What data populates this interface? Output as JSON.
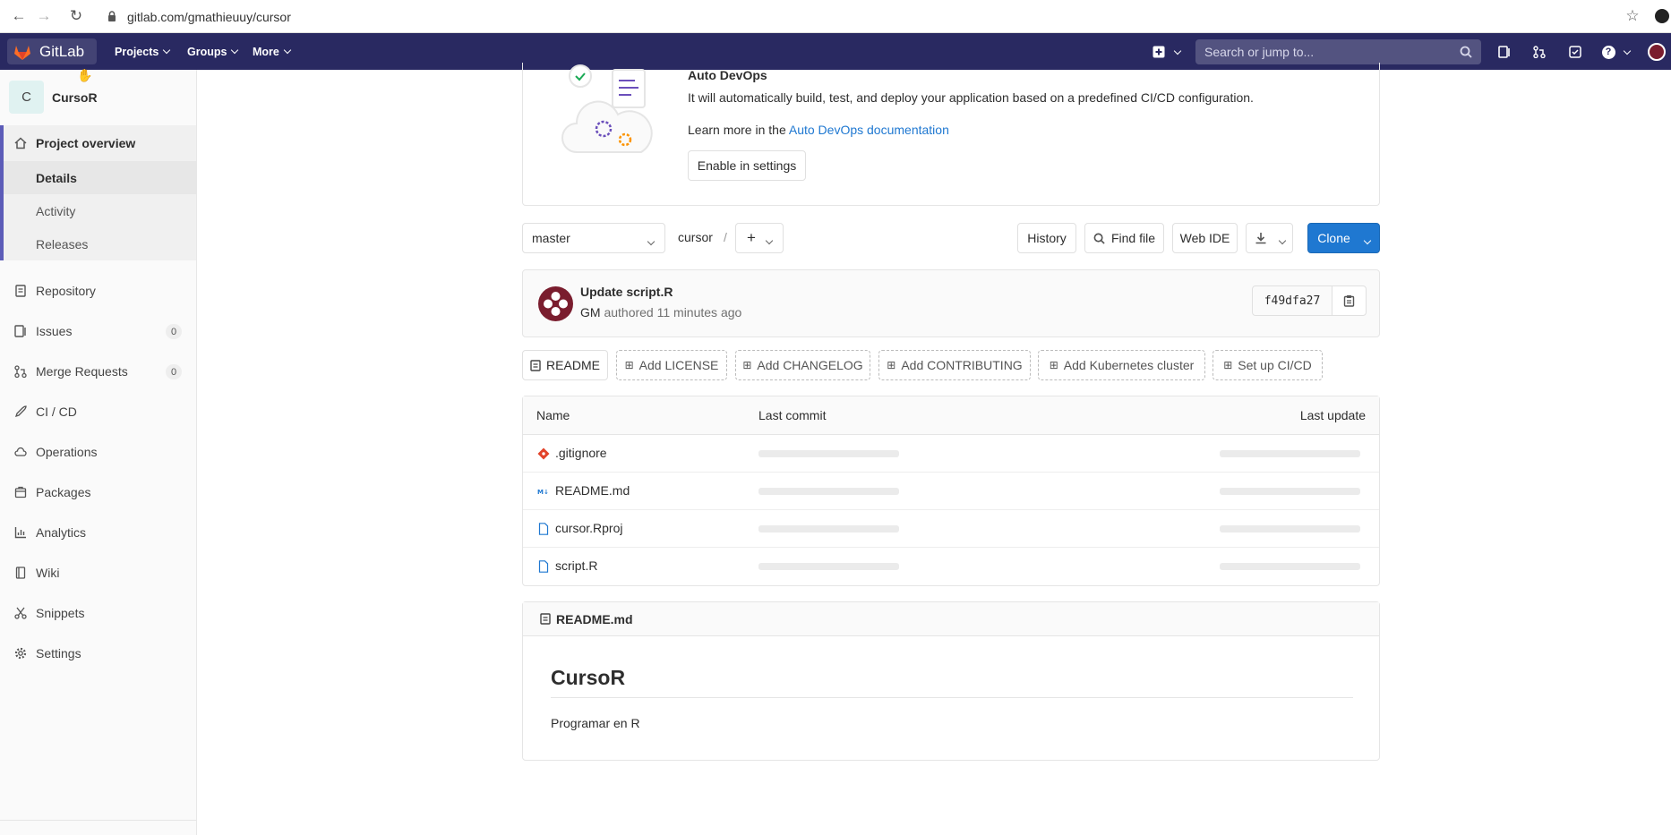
{
  "browser": {
    "url": "gitlab.com/gmathieuuy/cursor"
  },
  "topbar": {
    "brand": "GitLab",
    "nav": [
      "Projects",
      "Groups",
      "More"
    ],
    "search_placeholder": "Search or jump to..."
  },
  "sidebar": {
    "project_initial": "C",
    "project_name": "CursoR",
    "overview": "Project overview",
    "sub": [
      "Details",
      "Activity",
      "Releases"
    ],
    "items": [
      "Repository",
      "Issues",
      "Merge Requests",
      "CI / CD",
      "Operations",
      "Packages",
      "Analytics",
      "Wiki",
      "Snippets",
      "Settings"
    ],
    "issues_count": "0",
    "mr_count": "0"
  },
  "devops": {
    "title": "Auto DevOps",
    "description": "It will automatically build, test, and deploy your application based on a predefined CI/CD configuration.",
    "learn_prefix": "Learn more in the",
    "learn_link": "Auto DevOps documentation",
    "enable_button": "Enable in settings"
  },
  "repo_bar": {
    "branch": "master",
    "path": "cursor",
    "separator": "/",
    "history": "History",
    "find_file": "Find file",
    "web_ide": "Web IDE",
    "clone": "Clone"
  },
  "commit": {
    "title": "Update script.R",
    "author": "GM",
    "meta": "authored 11 minutes ago",
    "sha": "f49dfa27"
  },
  "quick_links": [
    "README",
    "Add LICENSE",
    "Add CHANGELOG",
    "Add CONTRIBUTING",
    "Add Kubernetes cluster",
    "Set up CI/CD"
  ],
  "tree": {
    "headers": [
      "Name",
      "Last commit",
      "Last update"
    ],
    "files": [
      ".gitignore",
      "README.md",
      "cursor.Rproj",
      "script.R"
    ]
  },
  "readme": {
    "file_label": "README.md",
    "heading": "CursoR",
    "body": "Programar en R"
  },
  "colors": {
    "topbar": "#292961",
    "primary": "#1f78d1",
    "sidebar_active": "#5c5cb8"
  }
}
